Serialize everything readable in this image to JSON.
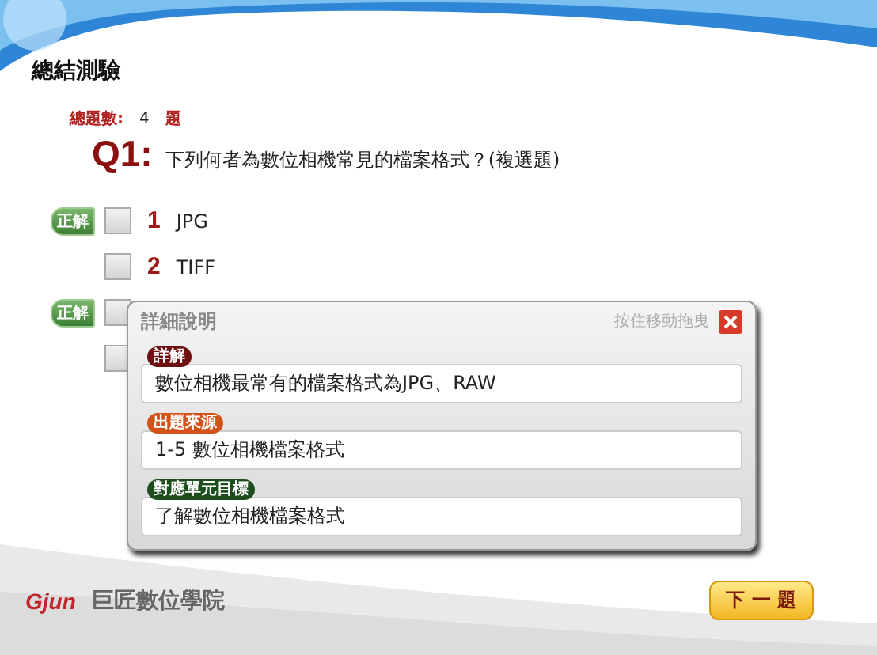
{
  "title": "總結測驗",
  "total": {
    "label": "總題數:",
    "count": "4",
    "unit": "題"
  },
  "question": {
    "number": "Q1:",
    "text": "下列何者為數位相機常見的檔案格式？(複選題)"
  },
  "options": [
    {
      "badge": "正解",
      "number": "1",
      "label": "JPG",
      "checked": false
    },
    {
      "number": "2",
      "label": "TIFF",
      "checked": false
    },
    {
      "badge": "正解",
      "checked": false
    },
    {
      "checked": false
    }
  ],
  "dialog": {
    "title": "詳細說明",
    "drag_hint": "按住移動拖曳",
    "sections": [
      {
        "label": "詳解",
        "color": "#6e0f12",
        "text": "數位相機最常有的檔案格式為JPG、RAW"
      },
      {
        "label": "出題來源",
        "color": "#d2521a",
        "text": "1-5 數位相機檔案格式"
      },
      {
        "label": "對應單元目標",
        "color": "#1d4d1d",
        "text": "了解數位相機檔案格式"
      }
    ]
  },
  "footer": {
    "logo": "Gjun",
    "school": "巨匠數位學院"
  },
  "next_button": "下 一 題"
}
